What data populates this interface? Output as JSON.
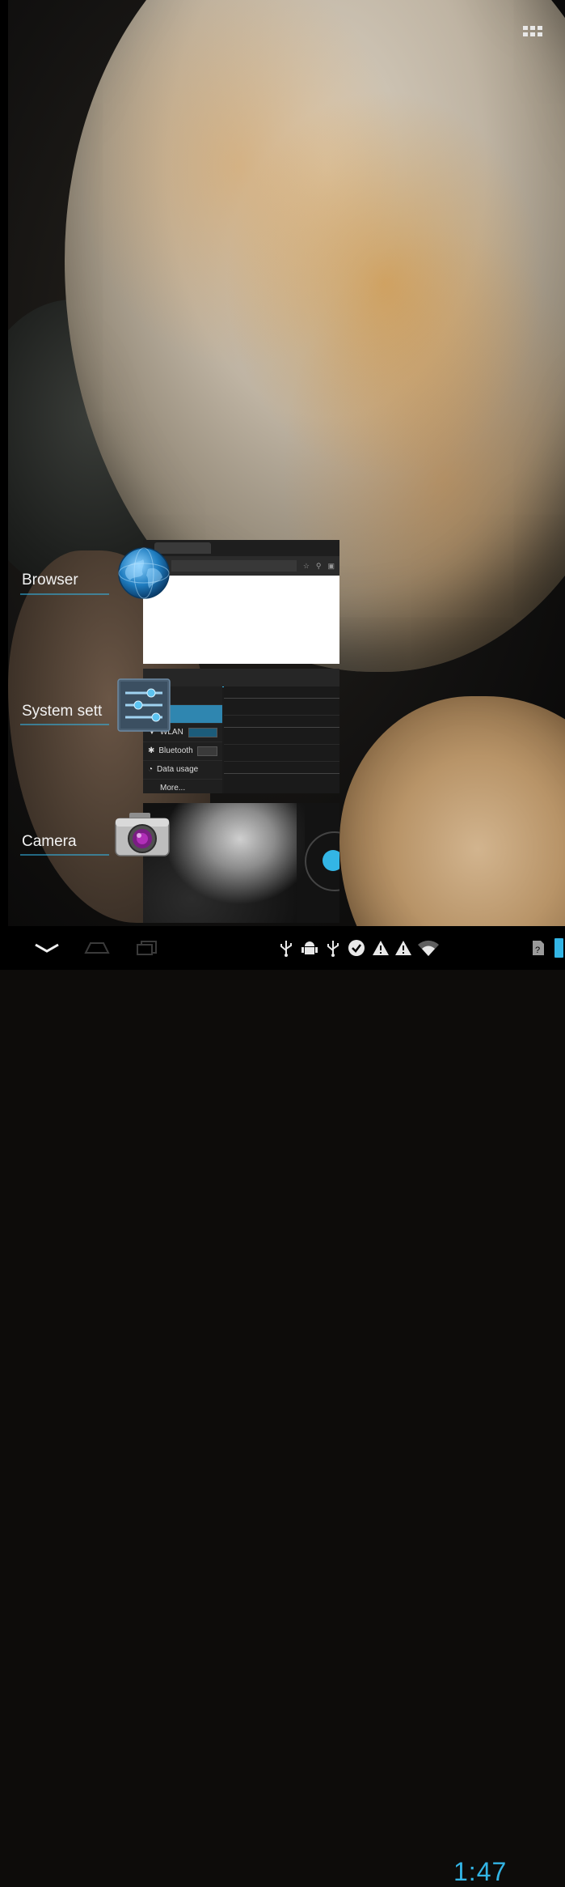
{
  "recent_apps": [
    {
      "label": "Browser",
      "icon": "globe-icon"
    },
    {
      "label": "System sett",
      "icon": "settings-sliders-icon"
    },
    {
      "label": "Camera",
      "icon": "camera-icon"
    }
  ],
  "settings_thumb": {
    "rows": [
      "WLAN",
      "Bluetooth",
      "Data usage",
      "More..."
    ],
    "wlan_toggle": "ON",
    "bt_toggle": "OFF"
  },
  "status_bar": {
    "time": "1:47",
    "icons": [
      "usb-icon",
      "android-debug-icon",
      "usb-icon",
      "check-circle-icon",
      "warning-icon",
      "warning-icon",
      "wifi-icon",
      "no-sim-icon",
      "battery-icon"
    ]
  },
  "nav": {
    "back": "back-icon",
    "home": "home-icon",
    "recent": "recent-apps-icon"
  },
  "colors": {
    "accent": "#33b5e5",
    "label": "#f2f2f2"
  }
}
